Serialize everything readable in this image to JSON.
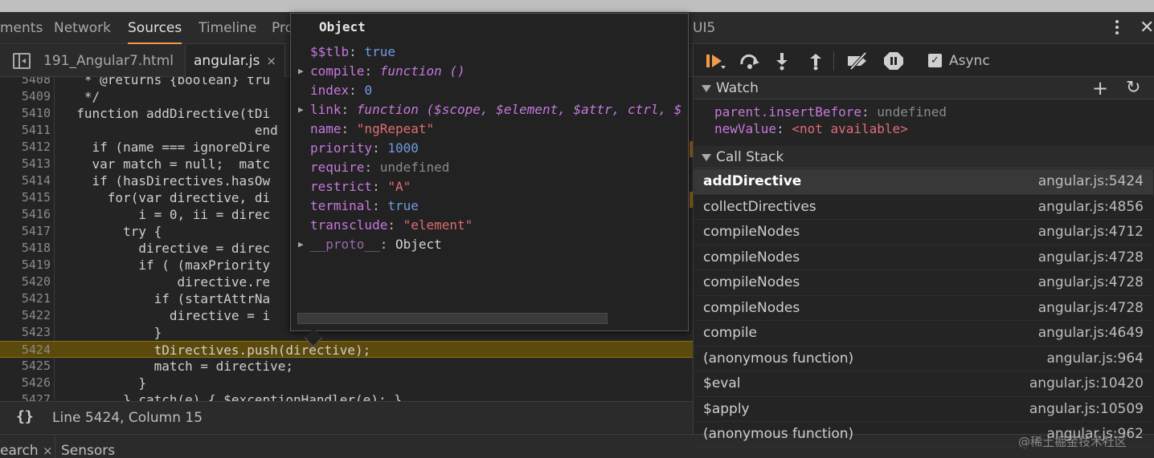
{
  "main_tabs": [
    {
      "label": "ments"
    },
    {
      "label": "Network"
    },
    {
      "label": "Sources",
      "active": true
    },
    {
      "label": "Timeline"
    },
    {
      "label": "Pro"
    },
    {
      "label": "UI5"
    }
  ],
  "file_tabs": [
    {
      "label": "191_Angular7.html"
    },
    {
      "label": "angular.js",
      "active": true,
      "close": "×"
    }
  ],
  "editor": {
    "lines": [
      {
        "n": "5408",
        "code": "   * @returns {boolean} tru"
      },
      {
        "n": "5409",
        "code": "   */"
      },
      {
        "n": "5410",
        "code": "  function addDirective(tDi"
      },
      {
        "n": "5411",
        "code": "                         end"
      },
      {
        "n": "5412",
        "code": "    if (name === ignoreDire"
      },
      {
        "n": "5413",
        "code": "    var match = null;  matc"
      },
      {
        "n": "5414",
        "code": "    if (hasDirectives.hasOw"
      },
      {
        "n": "5415",
        "code": "      for(var directive, di"
      },
      {
        "n": "5416",
        "code": "          i = 0, ii = direc"
      },
      {
        "n": "5417",
        "code": "        try {"
      },
      {
        "n": "5418",
        "code": "          directive = direc"
      },
      {
        "n": "5419",
        "code": "          if ( (maxPriority"
      },
      {
        "n": "5420",
        "code": "               directive.re"
      },
      {
        "n": "5421",
        "code": "            if (startAttrNa"
      },
      {
        "n": "5422",
        "code": "              directive = i"
      },
      {
        "n": "5423",
        "code": "            }"
      },
      {
        "n": "5424",
        "code": "            tDirectives.push(directive);"
      },
      {
        "n": "5425",
        "code": "            match = directive;"
      },
      {
        "n": "5426",
        "code": "          }"
      },
      {
        "n": "5427",
        "code": "        } catch(e) { $exceptionHandler(e); }"
      }
    ],
    "current_line": "5424"
  },
  "status": {
    "braces": "{}",
    "position": "Line 5424, Column 15"
  },
  "drawer_tabs": [
    {
      "label": "earch",
      "close": "×"
    },
    {
      "label": "Sensors"
    }
  ],
  "watermark": "@稀土掘金技术社区",
  "debugger": {
    "async_label": "Async",
    "async_checked": true,
    "watch_title": "Watch",
    "watch": [
      {
        "name": "parent.insertBefore",
        "value": "undefined",
        "available": true
      },
      {
        "name": "newValue",
        "value": "<not available>",
        "available": false
      }
    ],
    "callstack_title": "Call Stack",
    "frames": [
      {
        "name": "addDirective",
        "loc": "angular.js:5424",
        "selected": true
      },
      {
        "name": "collectDirectives",
        "loc": "angular.js:4856"
      },
      {
        "name": "compileNodes",
        "loc": "angular.js:4712"
      },
      {
        "name": "compileNodes",
        "loc": "angular.js:4728"
      },
      {
        "name": "compileNodes",
        "loc": "angular.js:4728"
      },
      {
        "name": "compileNodes",
        "loc": "angular.js:4728"
      },
      {
        "name": "compile",
        "loc": "angular.js:4649"
      },
      {
        "name": "(anonymous function)",
        "loc": "angular.js:964"
      },
      {
        "name": "$eval",
        "loc": "angular.js:10420"
      },
      {
        "name": "$apply",
        "loc": "angular.js:10509"
      },
      {
        "name": "(anonymous function)",
        "loc": "angular.js:962"
      }
    ]
  },
  "popover": {
    "title": "Object",
    "props": [
      {
        "key": "$$tlb",
        "value": "true",
        "kind": "bool"
      },
      {
        "key": "compile",
        "value": "function ()",
        "kind": "fn",
        "expandable": true
      },
      {
        "key": "index",
        "value": "0",
        "kind": "num"
      },
      {
        "key": "link",
        "value": "function ($scope, $element, $attr, ctrl, $",
        "kind": "fn",
        "expandable": true
      },
      {
        "key": "name",
        "value": "\"ngRepeat\"",
        "kind": "str"
      },
      {
        "key": "priority",
        "value": "1000",
        "kind": "num"
      },
      {
        "key": "require",
        "value": "undefined",
        "kind": "undef"
      },
      {
        "key": "restrict",
        "value": "\"A\"",
        "kind": "str"
      },
      {
        "key": "terminal",
        "value": "true",
        "kind": "bool"
      },
      {
        "key": "transclude",
        "value": "\"element\"",
        "kind": "str"
      },
      {
        "key": "__proto__",
        "value": "Object",
        "kind": "obj",
        "expandable": true,
        "dim": true
      }
    ]
  }
}
